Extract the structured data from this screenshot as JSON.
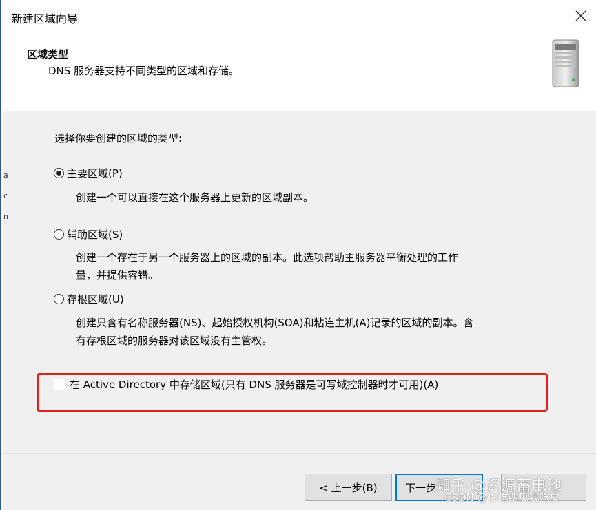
{
  "window": {
    "title": "新建区域向导"
  },
  "header": {
    "title": "区域类型",
    "subtitle": "DNS 服务器支持不同类型的区域和存储。"
  },
  "body": {
    "prompt": "选择你要创建的区域的类型:",
    "options": [
      {
        "label": "主要区域(P)",
        "selected": true,
        "description": "创建一个可以直接在这个服务器上更新的区域副本。"
      },
      {
        "label": "辅助区域(S)",
        "selected": false,
        "description_line1": "创建一个存在于另一个服务器上的区域的副本。此选项帮助主服务器平衡处理的工作",
        "description_line2": "量，并提供容错。"
      },
      {
        "label": "存根区域(U)",
        "selected": false,
        "description_line1": "创建只含有名称服务器(NS)、起始授权机构(SOA)和粘连主机(A)记录的区域的副本。含",
        "description_line2": "有存根区域的服务器对该区域没有主管权。"
      }
    ],
    "ad_store": {
      "label": "在 Active Directory 中存储区域(只有 DNS 服务器是可写域控制器时才可用)(A)",
      "checked": false
    }
  },
  "buttons": {
    "back": "< 上一步(B)",
    "next": "下一步"
  },
  "watermark": {
    "line1": "知乎 @资源蓄电池",
    "line2": "CSDN @你吃西瓜我吃皮"
  },
  "edge_fragments": [
    "a",
    "c",
    "n"
  ],
  "colors": {
    "highlight": "#e0201c",
    "accent": "#0078d7",
    "body_bg": "#f0f0f0"
  }
}
